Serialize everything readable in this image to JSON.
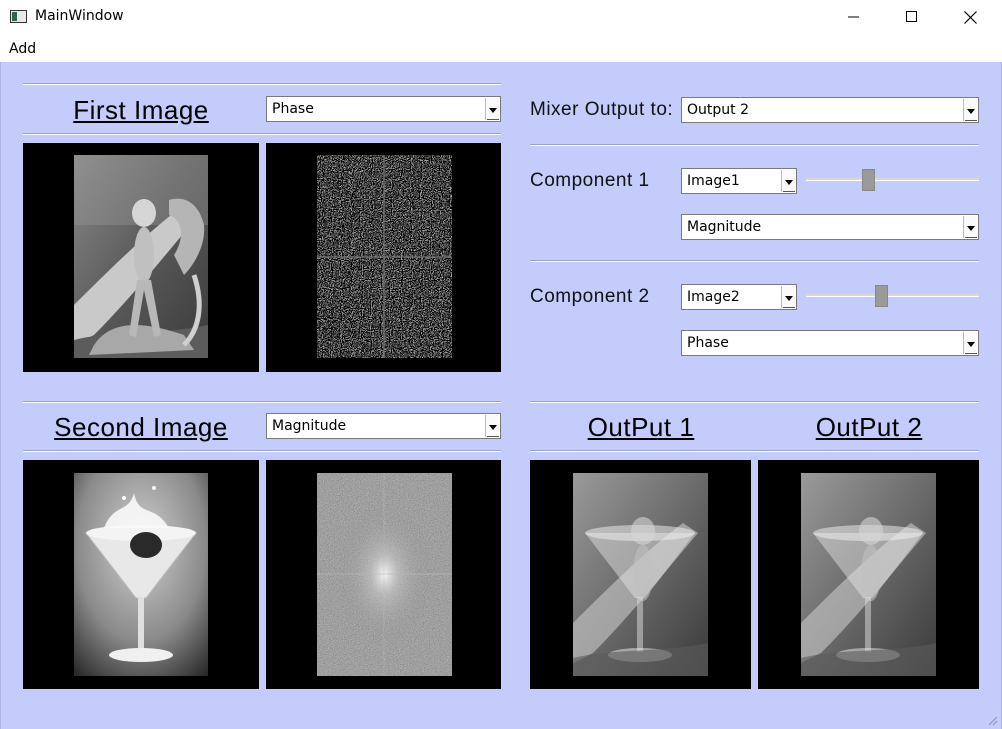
{
  "window": {
    "title": "MainWindow"
  },
  "menu": {
    "items": [
      "Add"
    ]
  },
  "first_image": {
    "heading": "First Image",
    "component": "Phase"
  },
  "second_image": {
    "heading": "Second Image",
    "component": "Magnitude"
  },
  "mixer": {
    "output_label": "Mixer Output to:",
    "output_value": "Output 2",
    "component1": {
      "label": "Component 1",
      "source": "Image1",
      "type": "Magnitude",
      "slider_value": 0.35
    },
    "component2": {
      "label": "Component 2",
      "source": "Image2",
      "type": "Phase",
      "slider_value": 0.43
    }
  },
  "outputs": {
    "output1_heading": "OutPut 1",
    "output2_heading": "OutPut 2"
  }
}
